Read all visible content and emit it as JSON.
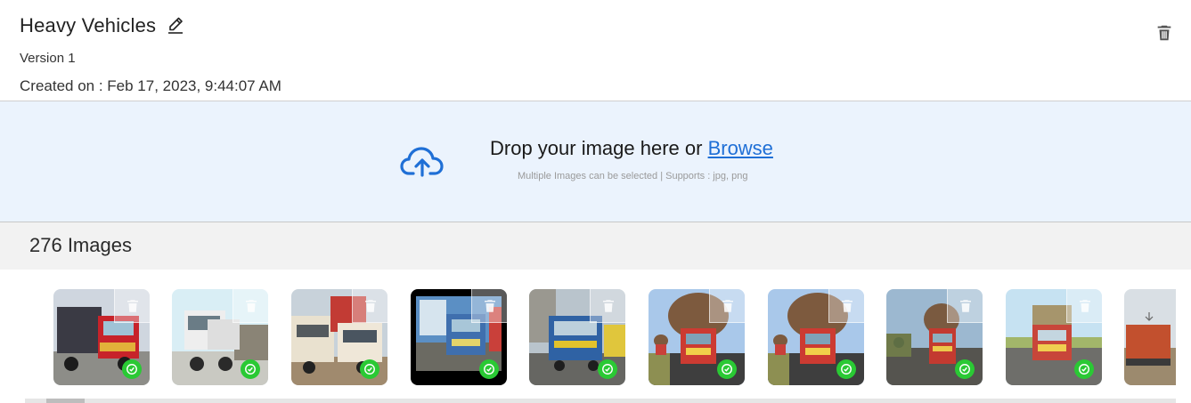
{
  "header": {
    "title": "Heavy Vehicles",
    "version": "Version 1",
    "created": "Created on : Feb 17, 2023, 9:44:07 AM"
  },
  "dropzone": {
    "prompt": "Drop your image here or ",
    "browse_label": "Browse",
    "hint": "Multiple Images can be selected | Supports : jpg, png"
  },
  "gallery": {
    "count_label": "276 Images",
    "items": [
      {
        "icon": "truck-red-image",
        "status": "uploaded"
      },
      {
        "icon": "dumper-white-image",
        "status": "uploaded"
      },
      {
        "icon": "trucks-yard-image",
        "status": "uploaded"
      },
      {
        "icon": "bus-painting-image",
        "status": "uploaded"
      },
      {
        "icon": "bus-road-image",
        "status": "uploaded"
      },
      {
        "icon": "loaded-truck-image",
        "status": "uploaded"
      },
      {
        "icon": "loaded-truck-image",
        "status": "uploaded"
      },
      {
        "icon": "loaded-truck-road-image",
        "status": "uploaded"
      },
      {
        "icon": "cargo-truck-image",
        "status": "uploaded"
      },
      {
        "icon": "truck-field-image",
        "status": "uploaded"
      }
    ]
  },
  "colors": {
    "accent": "#1f6fd6",
    "dropzone_bg": "#ebf3fd",
    "success": "#2ac934"
  }
}
